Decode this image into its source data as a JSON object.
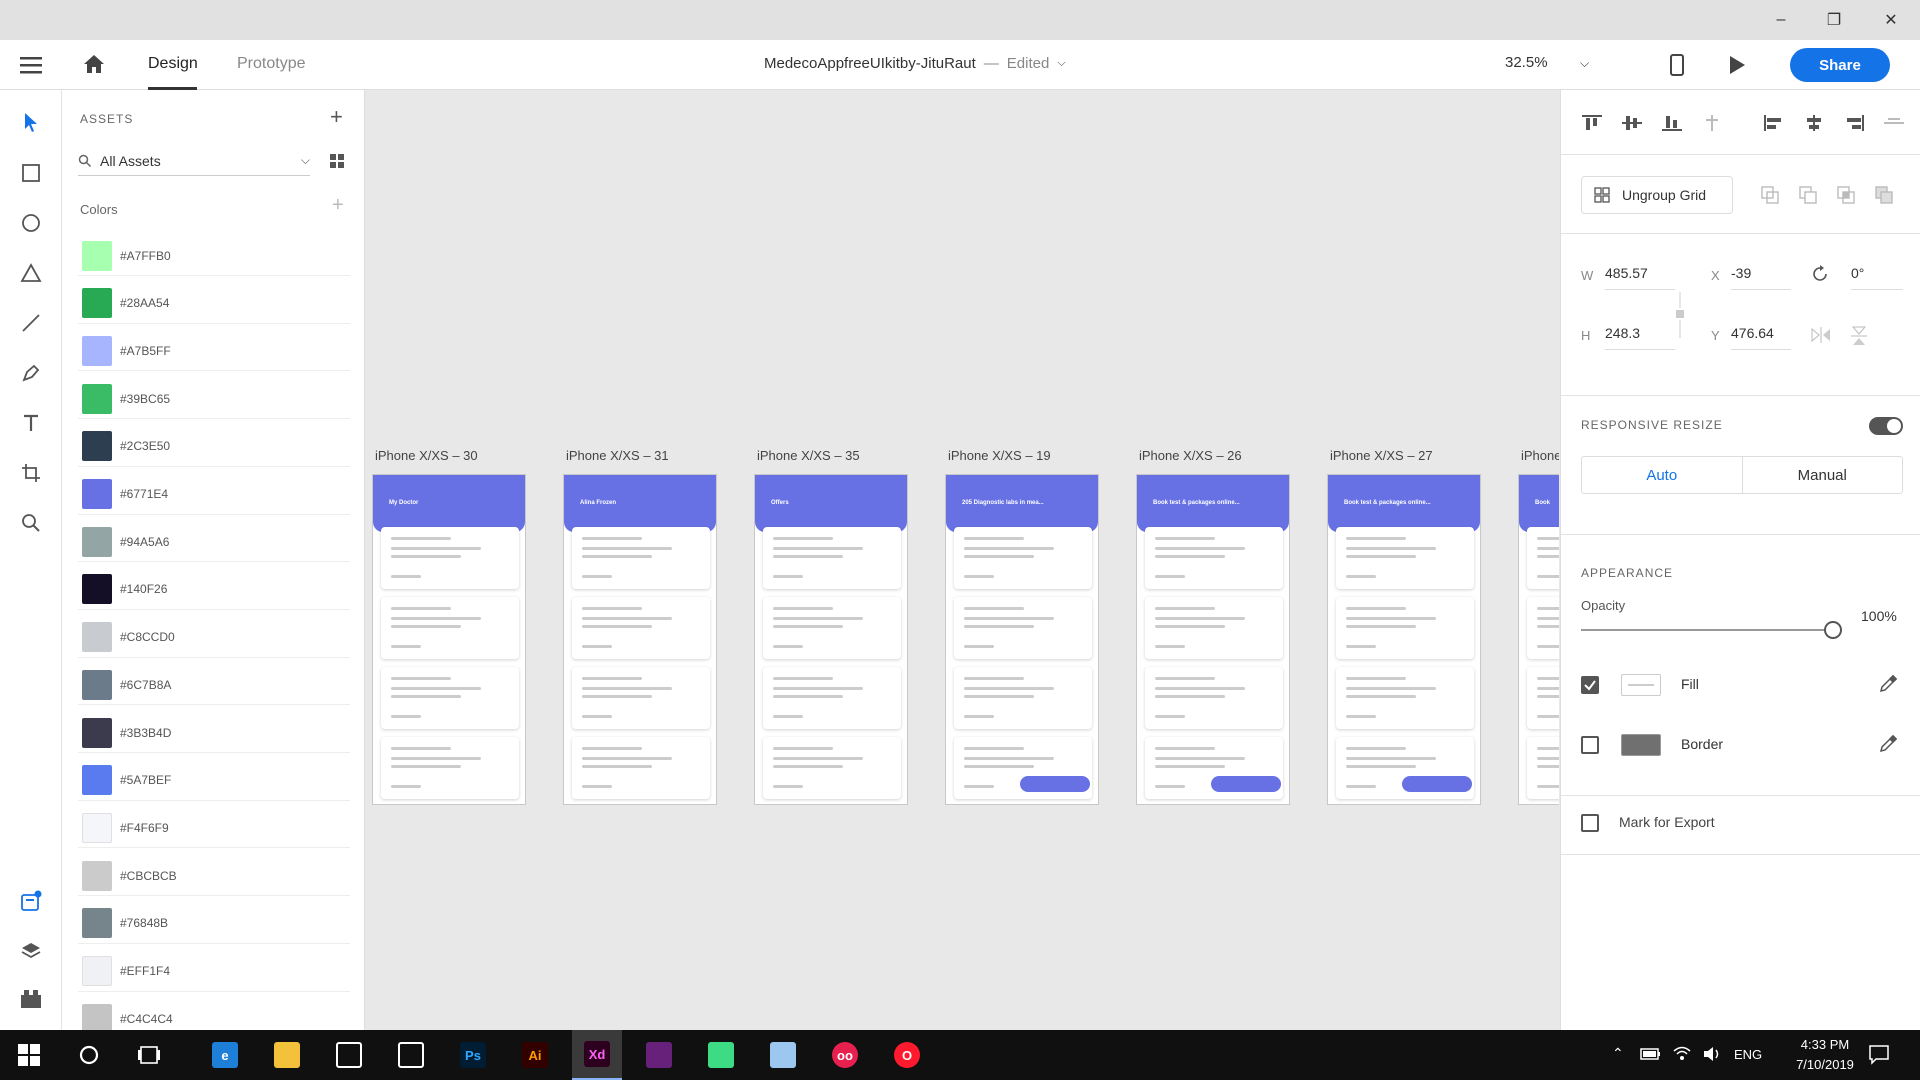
{
  "app": {
    "tabs": [
      "Design",
      "Prototype"
    ],
    "document_title": "MedecoAppfreeUIkitby-JituRaut",
    "status": "Edited",
    "separator": "—",
    "zoom": "32.5%",
    "share_label": "Share"
  },
  "assets": {
    "heading": "ASSETS",
    "filter": "All Assets",
    "colors_heading": "Colors",
    "colors": [
      "#A7FFB0",
      "#28AA54",
      "#A7B5FF",
      "#39BC65",
      "#2C3E50",
      "#6771E4",
      "#94A5A6",
      "#140F26",
      "#C8CCD0",
      "#6C7B8A",
      "#3B3B4D",
      "#5A7BEF",
      "#F4F6F9",
      "#CBCBCB",
      "#76848B",
      "#EFF1F4",
      "#C4C4C4"
    ]
  },
  "artboards": [
    {
      "label": "iPhone X/XS – 30",
      "title": "My Doctor"
    },
    {
      "label": "iPhone X/XS – 31",
      "title": "Alina Frozen"
    },
    {
      "label": "iPhone X/XS – 35",
      "title": "Offers"
    },
    {
      "label": "iPhone X/XS – 19",
      "title": "205 Diagnostic labs in mea..."
    },
    {
      "label": "iPhone X/XS – 26",
      "title": "Book test & packages online..."
    },
    {
      "label": "iPhone X/XS – 27",
      "title": "Book test & packages online..."
    },
    {
      "label": "iPhone",
      "title": "Book"
    }
  ],
  "properties": {
    "ungroup_label": "Ungroup Grid",
    "w_label": "W",
    "w_value": "485.57",
    "h_label": "H",
    "h_value": "248.3",
    "x_label": "X",
    "x_value": "-39",
    "y_label": "Y",
    "y_value": "476.64",
    "rotation": "0°",
    "responsive_resize": "RESPONSIVE RESIZE",
    "auto_label": "Auto",
    "manual_label": "Manual",
    "appearance": "APPEARANCE",
    "opacity_label": "Opacity",
    "opacity_value": "100%",
    "opacity_level": 1.0,
    "fill_label": "Fill",
    "fill_checked": true,
    "border_label": "Border",
    "border_checked": false,
    "export_label": "Mark for Export",
    "export_checked": false
  },
  "taskbar": {
    "language": "ENG",
    "time": "4:33 PM",
    "date": "7/10/2019",
    "apps": [
      "edge",
      "file-explorer",
      "store",
      "mail",
      "photoshop",
      "illustrator",
      "xd",
      "visual-studio",
      "android-studio",
      "virtualbox",
      "flickr",
      "opera"
    ]
  },
  "accent": "#1473e6"
}
